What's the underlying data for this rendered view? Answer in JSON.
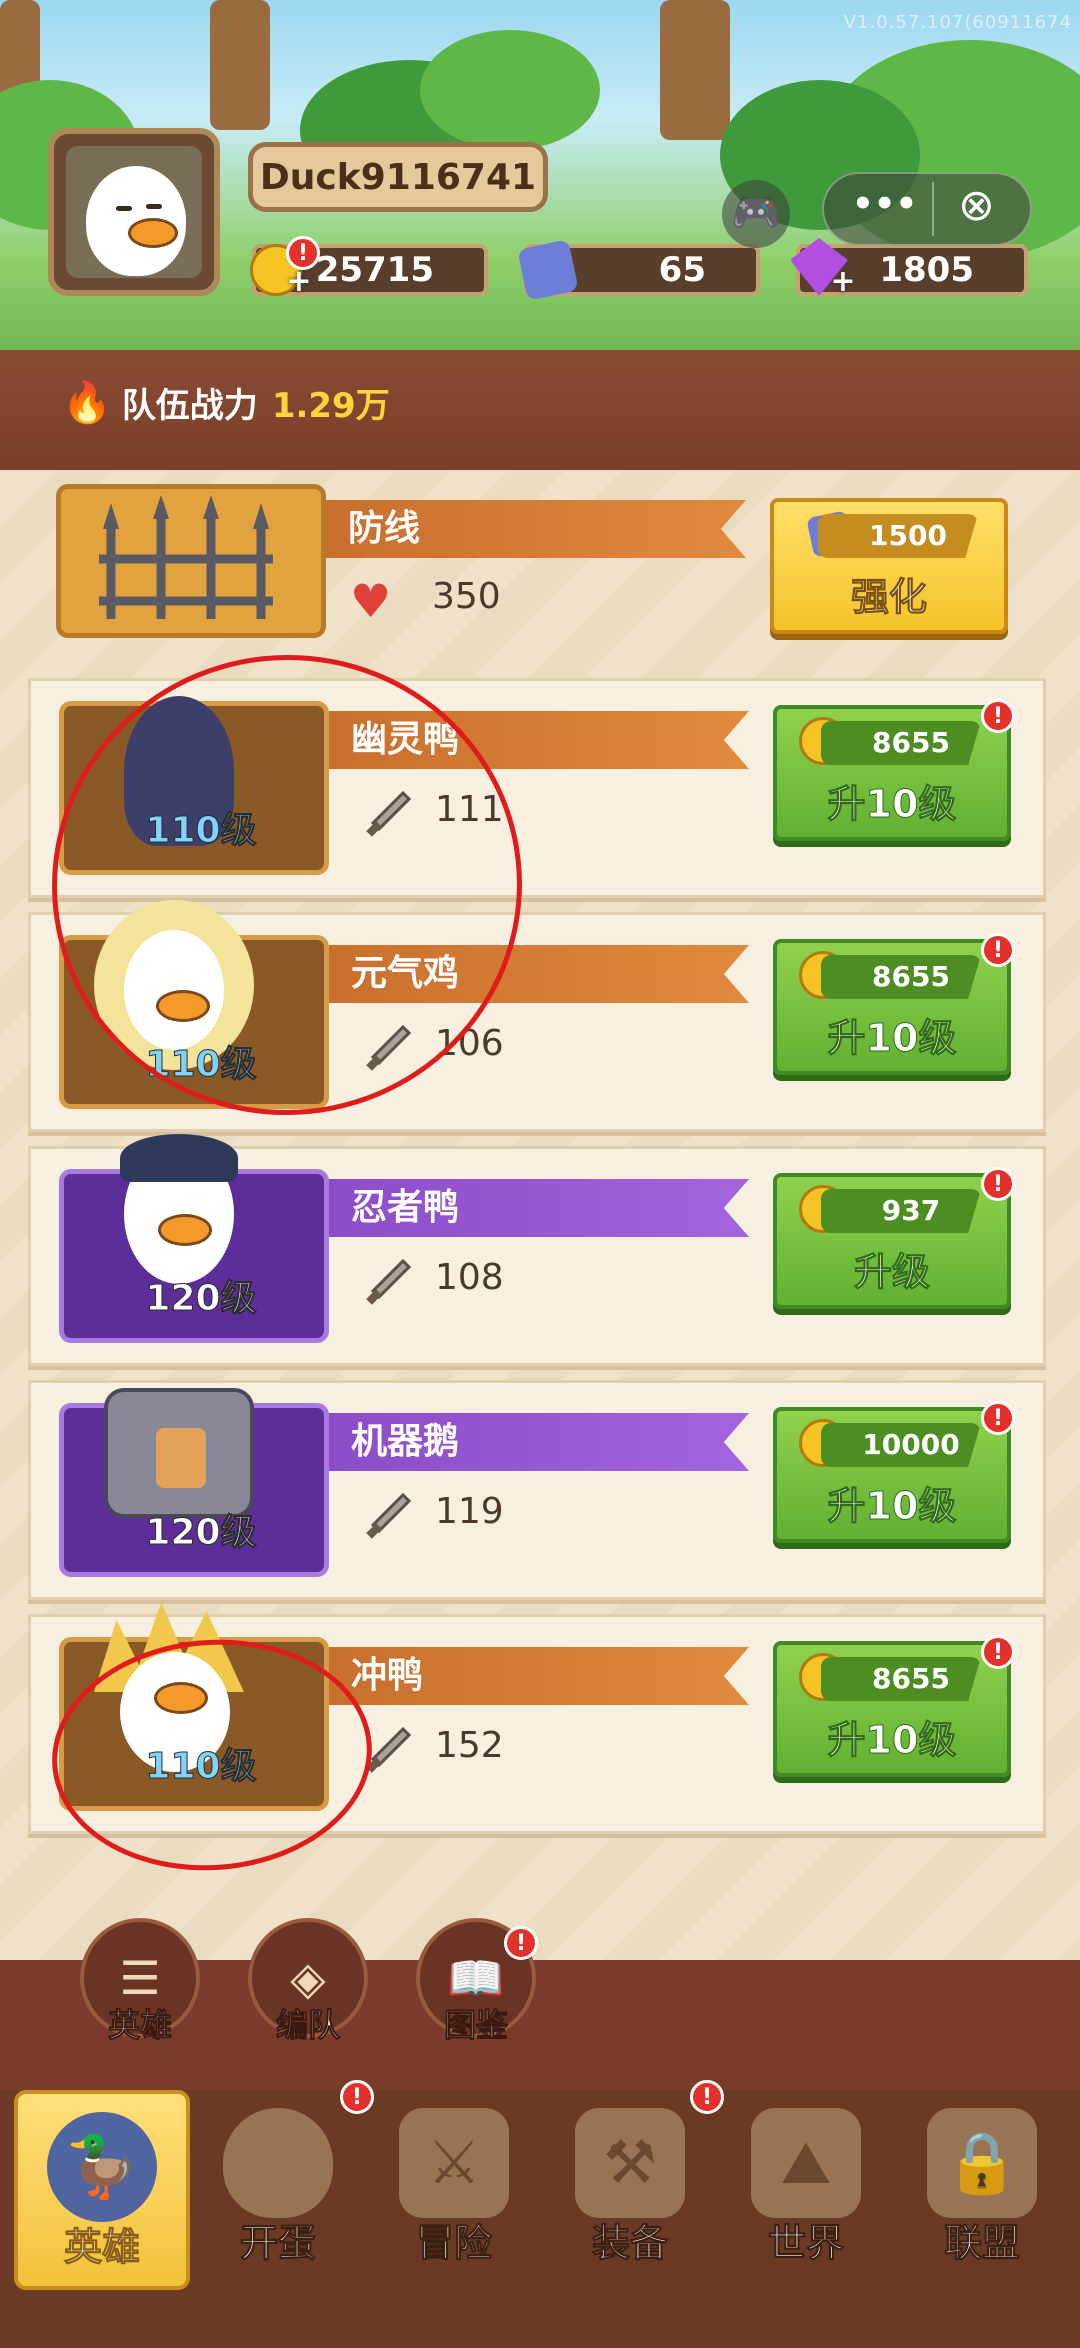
{
  "header": {
    "version": "V1.0.57.107(60911674",
    "player_name": "Duck9116741",
    "resources": [
      {
        "icon": "gold-coin-icon",
        "value": "25715",
        "has_plus": true,
        "badge": "!"
      },
      {
        "icon": "gem-token-icon",
        "value": "65",
        "has_plus": false
      },
      {
        "icon": "purple-diamond-icon",
        "value": "1805",
        "has_plus": true
      }
    ],
    "capsule_more": "•••",
    "capsule_close": "⊗"
  },
  "power": {
    "label": "队伍战力",
    "value": "1.29万"
  },
  "defense": {
    "name": "防线",
    "hp": "350",
    "upgrade_cost": "1500",
    "upgrade_label": "强化"
  },
  "heroes": [
    {
      "name": "幽灵鸭",
      "level": "110级",
      "attack": "111",
      "cost": "8655",
      "button": "升10级",
      "badge": "!",
      "rarity": "orange"
    },
    {
      "name": "元气鸡",
      "level": "110级",
      "attack": "106",
      "cost": "8655",
      "button": "升10级",
      "badge": "!",
      "rarity": "orange"
    },
    {
      "name": "忍者鸭",
      "level": "120级",
      "attack": "108",
      "cost": "937",
      "button": "升级",
      "badge": "!",
      "rarity": "purple"
    },
    {
      "name": "机器鹅",
      "level": "120级",
      "attack": "119",
      "cost": "10000",
      "button": "升10级",
      "badge": "!",
      "rarity": "purple"
    },
    {
      "name": "冲鸭",
      "level": "110级",
      "attack": "152",
      "cost": "8655",
      "button": "升10级",
      "badge": "!",
      "rarity": "orange"
    }
  ],
  "sub_nav": [
    {
      "label": "英雄",
      "icon": "list-icon"
    },
    {
      "label": "编队",
      "icon": "formation-icon"
    },
    {
      "label": "图鉴",
      "icon": "book-icon",
      "badge": "!"
    }
  ],
  "tabs": [
    {
      "label": "英雄",
      "icon": "hero-icon",
      "active": true
    },
    {
      "label": "开蛋",
      "icon": "egg-icon",
      "badge": "!"
    },
    {
      "label": "冒险",
      "icon": "crossed-swords-icon"
    },
    {
      "label": "装备",
      "icon": "anvil-icon",
      "badge": "!"
    },
    {
      "label": "世界",
      "icon": "map-icon"
    },
    {
      "label": "联盟",
      "icon": "lock-icon"
    }
  ]
}
